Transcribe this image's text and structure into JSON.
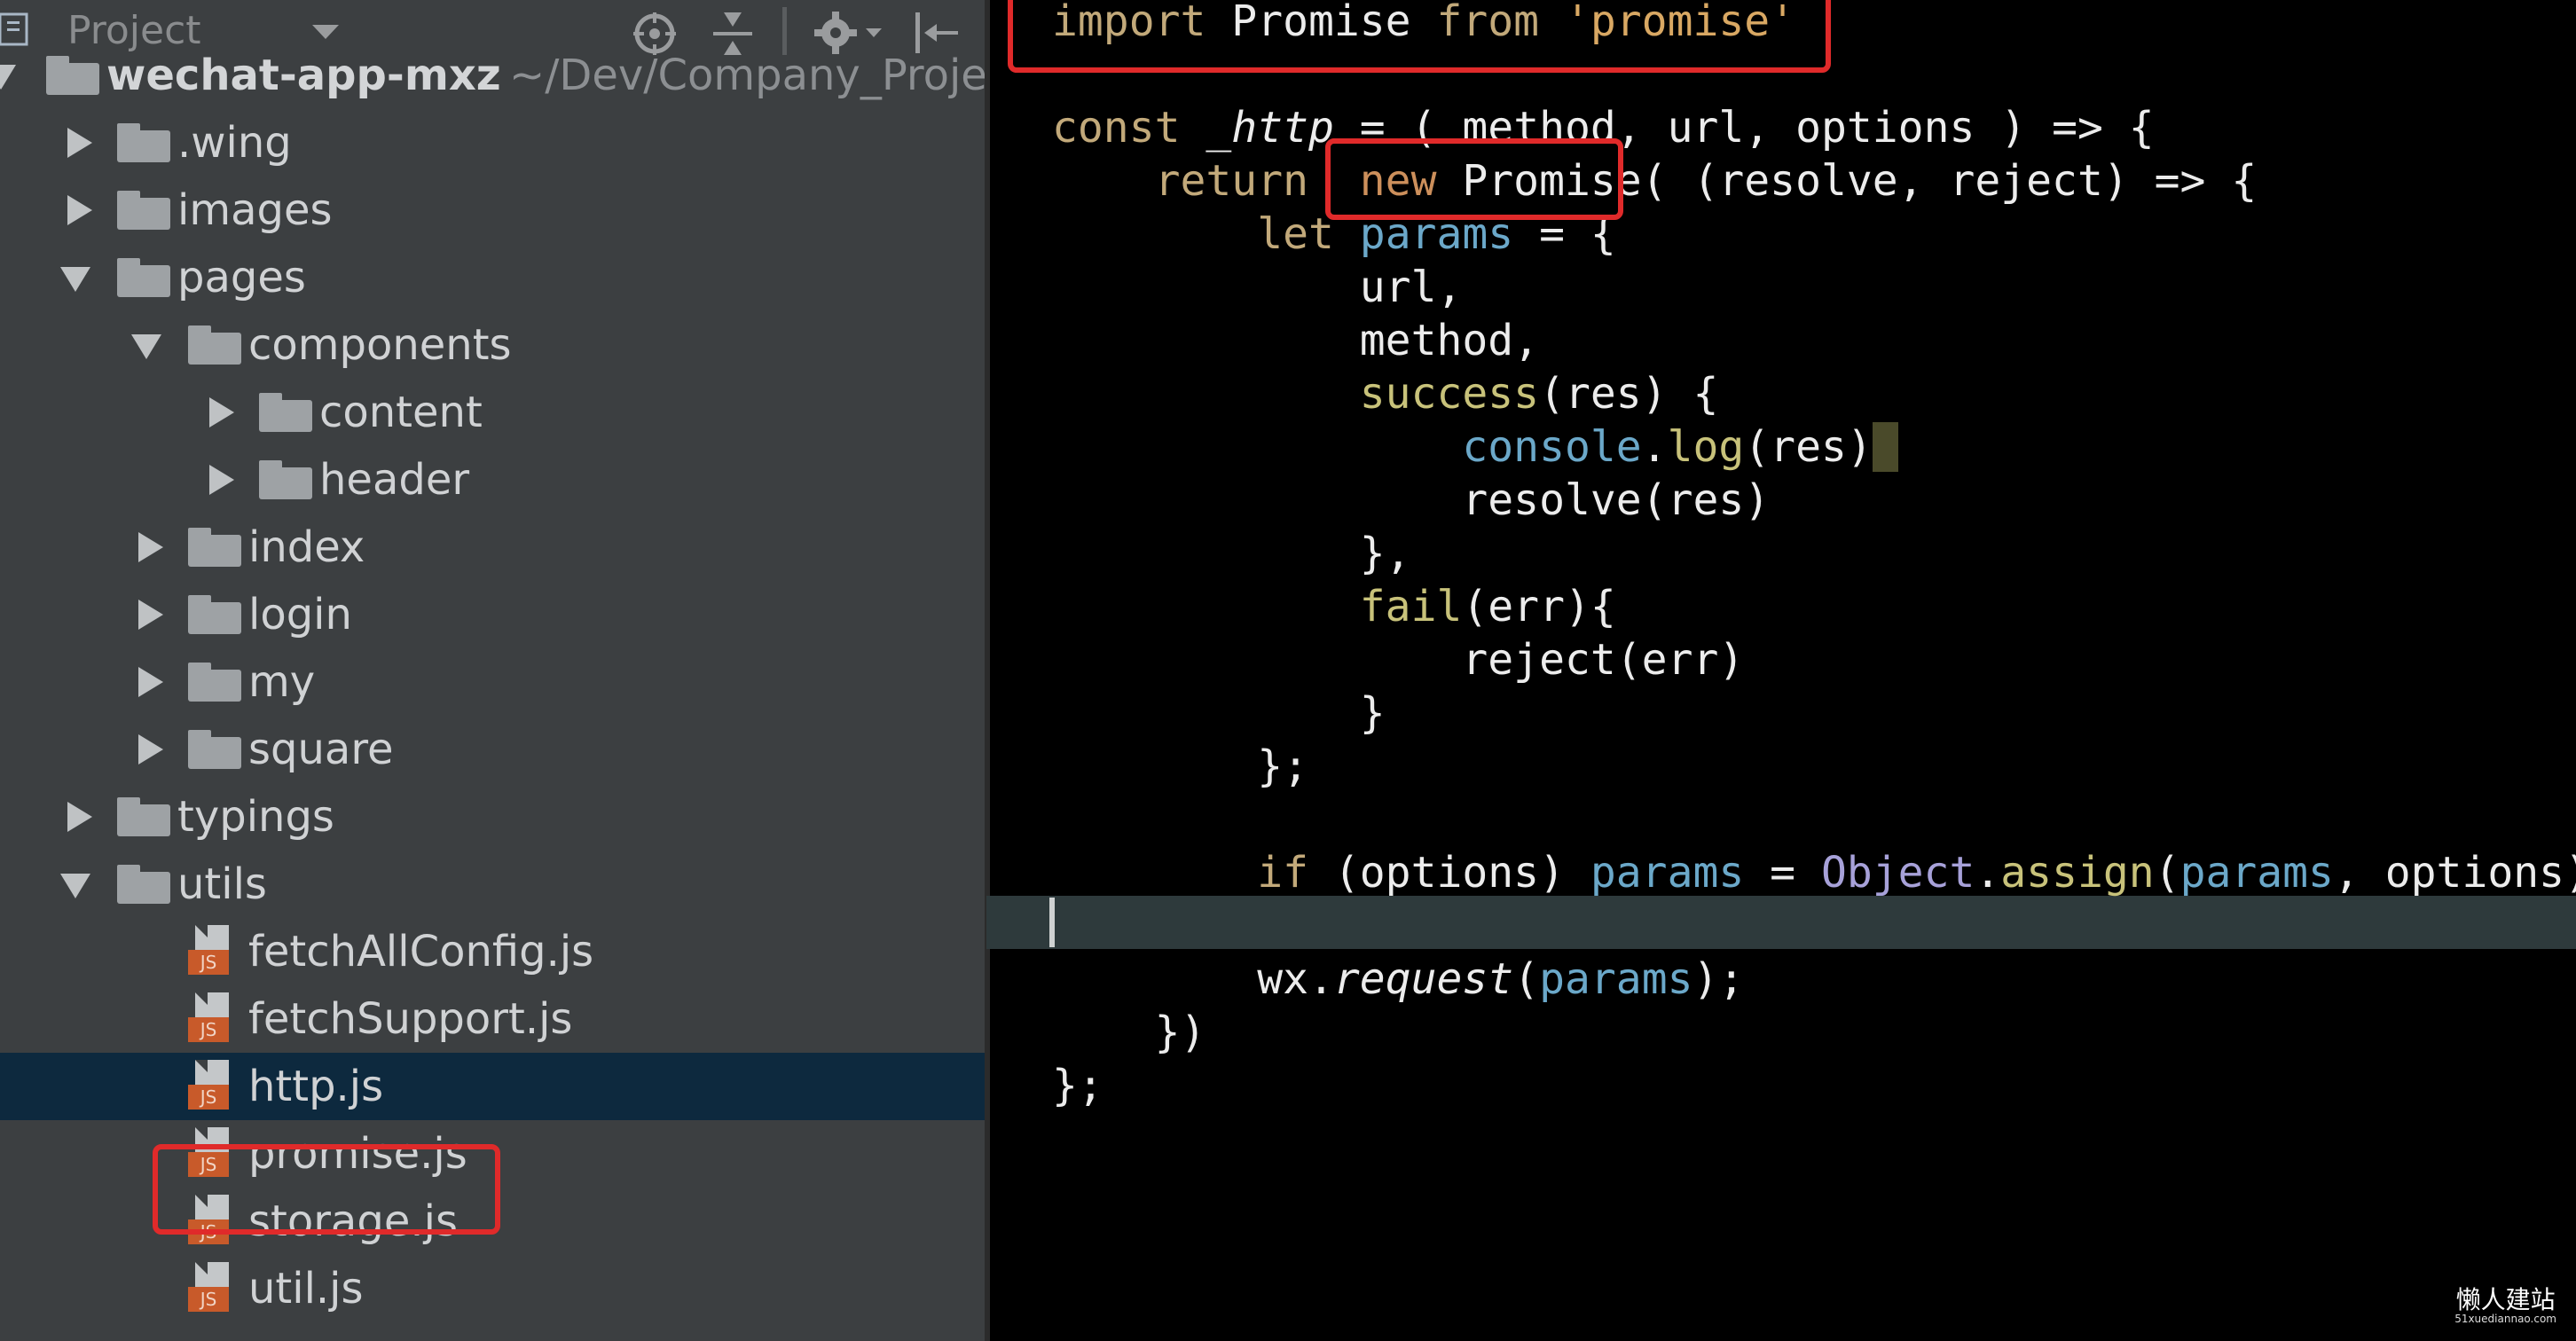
{
  "sidebar": {
    "title": "Project",
    "toolbar_icons": [
      "locate-icon",
      "collapse-icon",
      "gear-icon",
      "hide-icon"
    ],
    "tree": [
      {
        "label": "wechat-app-mxz",
        "path": "~/Dev/Company_Proje",
        "type": "folder",
        "expanded": true,
        "depth": 0
      },
      {
        "label": ".wing",
        "type": "folder",
        "expanded": false,
        "depth": 1
      },
      {
        "label": "images",
        "type": "folder",
        "expanded": false,
        "depth": 1
      },
      {
        "label": "pages",
        "type": "folder",
        "expanded": true,
        "depth": 1
      },
      {
        "label": "components",
        "type": "folder",
        "expanded": true,
        "depth": 2
      },
      {
        "label": "content",
        "type": "folder",
        "expanded": false,
        "depth": 3
      },
      {
        "label": "header",
        "type": "folder",
        "expanded": false,
        "depth": 3
      },
      {
        "label": "index",
        "type": "folder",
        "expanded": false,
        "depth": 2
      },
      {
        "label": "login",
        "type": "folder",
        "expanded": false,
        "depth": 2
      },
      {
        "label": "my",
        "type": "folder",
        "expanded": false,
        "depth": 2
      },
      {
        "label": "square",
        "type": "folder",
        "expanded": false,
        "depth": 2
      },
      {
        "label": "typings",
        "type": "folder",
        "expanded": false,
        "depth": 1
      },
      {
        "label": "utils",
        "type": "folder",
        "expanded": true,
        "depth": 1
      },
      {
        "label": "fetchAllConfig.js",
        "type": "file",
        "depth": 2
      },
      {
        "label": "fetchSupport.js",
        "type": "file",
        "depth": 2
      },
      {
        "label": "http.js",
        "type": "file",
        "depth": 2,
        "selected": true
      },
      {
        "label": "promise.js",
        "type": "file",
        "depth": 2,
        "highlighted": true
      },
      {
        "label": "storage.js",
        "type": "file",
        "depth": 2
      },
      {
        "label": "util.js",
        "type": "file",
        "depth": 2
      }
    ],
    "file_badge": "JS"
  },
  "editor": {
    "lines": [
      {
        "l": 0,
        "t": [
          [
            "kw",
            "import"
          ],
          [
            "id",
            " Promise "
          ],
          [
            "kw",
            "from"
          ],
          [
            "str",
            " 'promise'"
          ]
        ]
      },
      {
        "l": 1,
        "t": []
      },
      {
        "l": 2,
        "t": [
          [
            "kw",
            "const"
          ],
          [
            "id",
            " "
          ],
          [
            "id it",
            "_http"
          ],
          [
            "id",
            " = ( method, url, options ) => {"
          ]
        ]
      },
      {
        "l": 3,
        "t": [
          [
            "id",
            "    "
          ],
          [
            "kw",
            "return"
          ],
          [
            "id",
            "  "
          ],
          [
            "kw2",
            "new"
          ],
          [
            "id",
            " Promise( (resolve, reject) => {"
          ]
        ]
      },
      {
        "l": 4,
        "t": [
          [
            "id",
            "        "
          ],
          [
            "kw",
            "let"
          ],
          [
            "id",
            " "
          ],
          [
            "par",
            "params"
          ],
          [
            "id",
            " = {"
          ]
        ]
      },
      {
        "l": 5,
        "t": [
          [
            "id",
            "            url,"
          ]
        ]
      },
      {
        "l": 6,
        "t": [
          [
            "id",
            "            method,"
          ]
        ]
      },
      {
        "l": 7,
        "t": [
          [
            "id",
            "            "
          ],
          [
            "fn",
            "success"
          ],
          [
            "id",
            "(res) {"
          ]
        ]
      },
      {
        "l": 8,
        "t": [
          [
            "id",
            "                "
          ],
          [
            "par",
            "console"
          ],
          [
            "id",
            "."
          ],
          [
            "fn",
            "log"
          ],
          [
            "id",
            "(res)"
          ],
          [
            "id bracket-hl",
            " "
          ]
        ]
      },
      {
        "l": 9,
        "t": [
          [
            "id",
            "                resolve(res)"
          ]
        ]
      },
      {
        "l": 10,
        "t": [
          [
            "id",
            "            },"
          ]
        ]
      },
      {
        "l": 11,
        "t": [
          [
            "id",
            "            "
          ],
          [
            "fn",
            "fail"
          ],
          [
            "id",
            "(err){"
          ]
        ]
      },
      {
        "l": 12,
        "t": [
          [
            "id",
            "                reject(err)"
          ]
        ]
      },
      {
        "l": 13,
        "t": [
          [
            "id",
            "            }"
          ]
        ]
      },
      {
        "l": 14,
        "t": [
          [
            "id",
            "        };"
          ]
        ]
      },
      {
        "l": 15,
        "t": []
      },
      {
        "l": 16,
        "t": [
          [
            "id",
            "        "
          ],
          [
            "kw",
            "if"
          ],
          [
            "id",
            " (options) "
          ],
          [
            "par",
            "params"
          ],
          [
            "id",
            " = "
          ],
          [
            "obj",
            "Object"
          ],
          [
            "id",
            "."
          ],
          [
            "fn",
            "assign"
          ],
          [
            "id",
            "("
          ],
          [
            "par",
            "params"
          ],
          [
            "id",
            ", options);"
          ]
        ]
      },
      {
        "l": 17,
        "t": []
      },
      {
        "l": 18,
        "t": [
          [
            "id",
            "        wx."
          ],
          [
            "id it",
            "request"
          ],
          [
            "id",
            "("
          ],
          [
            "par",
            "params"
          ],
          [
            "id",
            ");"
          ]
        ]
      },
      {
        "l": 19,
        "t": [
          [
            "id",
            "    })"
          ]
        ]
      },
      {
        "l": 20,
        "t": [
          [
            "id",
            "};"
          ]
        ]
      }
    ]
  },
  "watermark": {
    "title": "懒人建站",
    "site": "51xuediannao.com"
  }
}
